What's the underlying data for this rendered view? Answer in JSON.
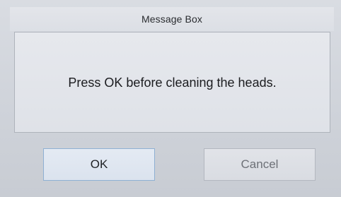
{
  "dialog": {
    "title": "Message Box",
    "message": "Press OK before cleaning the heads.",
    "buttons": {
      "ok_label": "OK",
      "cancel_label": "Cancel"
    }
  },
  "colors": {
    "ok_border": "#8fb0d3",
    "cancel_text": "#6d7077",
    "panel_border": "#aeb3bb"
  }
}
